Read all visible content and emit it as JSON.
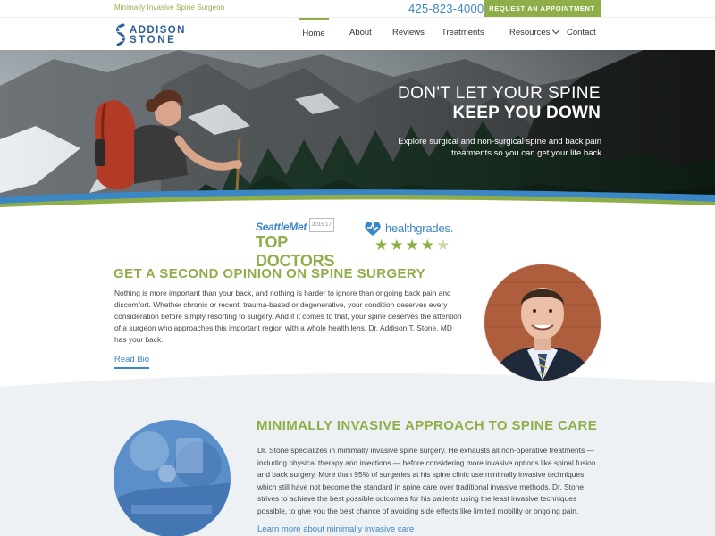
{
  "topbar": {
    "tagline": "Minimally Invasive Spine Surgeon",
    "phone": "425-823-4000",
    "cta_label": "REQUEST AN APPOINTMENT"
  },
  "brand": {
    "line1": "ADDISON",
    "line2": "STONE"
  },
  "nav": {
    "items": [
      {
        "label": "Home",
        "active": true
      },
      {
        "label": "About"
      },
      {
        "label": "Reviews"
      },
      {
        "label": "Treatments"
      },
      {
        "label": "Resources",
        "has_dropdown": true
      },
      {
        "label": "Contact"
      }
    ]
  },
  "hero": {
    "title_line1": "DON'T LET YOUR SPINE",
    "title_line2": "KEEP YOU DOWN",
    "subtitle": "Explore surgical and non-surgical spine and back pain treatments so you can get your life back"
  },
  "badges": {
    "seattle_brand": "SeattleMet",
    "seattle_years": "2015 17",
    "seattle_award": "TOP DOCTORS",
    "healthgrades_name": "healthgrades.",
    "healthgrades_stars": 4.5
  },
  "section1": {
    "title": "GET A SECOND OPINION ON SPINE SURGERY",
    "body": "Nothing is more important than your back, and nothing is harder to ignore than ongoing back pain and discomfort. Whether chronic or recent, trauma-based or degenerative, your condition deserves every consideration before simply resorting to surgery. And if it comes to that, your spine deserves the attention of a surgeon who approaches this important region with a whole health lens. Dr. Addison T. Stone, MD has your back.",
    "link": "Read Bio"
  },
  "section2": {
    "title": "MINIMALLY INVASIVE APPROACH TO SPINE CARE",
    "body": "Dr. Stone specializes in minimally invasive spine surgery. He exhausts all non-operative treatments — including physical therapy and injections — before considering more invasive options like spinal fusion and back surgery. More than 95% of surgeries at his spine clinic use minimally invasive techniques, which still have not become the standard in spine care over traditional invasive methods. Dr. Stone strives to achieve the best possible outcomes for his patients using the least invasive techniques possible, to give you the best chance of avoiding side effects like limited mobility or ongoing pain.",
    "link": "Learn more about minimally invasive care"
  },
  "colors": {
    "green": "#8fae4a",
    "blue": "#3b86c4",
    "navy": "#2c5e9a",
    "light_bg": "#eef1f3"
  }
}
